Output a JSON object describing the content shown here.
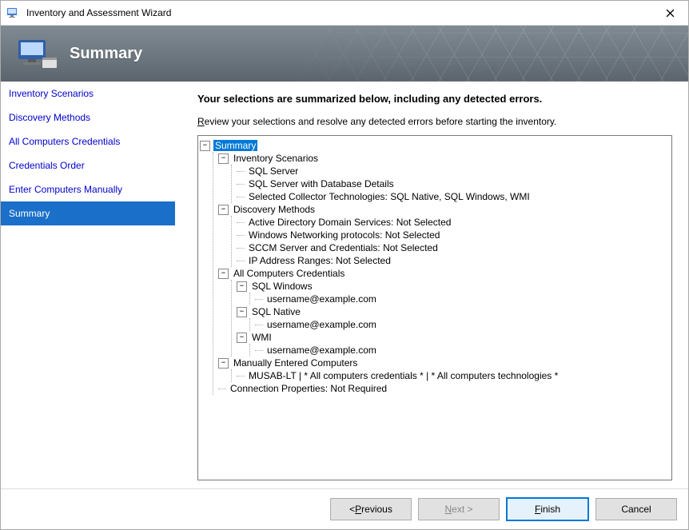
{
  "window": {
    "title": "Inventory and Assessment Wizard"
  },
  "banner": {
    "title": "Summary"
  },
  "sidebar": {
    "items": [
      {
        "label": "Inventory Scenarios",
        "active": false
      },
      {
        "label": "Discovery Methods",
        "active": false
      },
      {
        "label": "All Computers Credentials",
        "active": false
      },
      {
        "label": "Credentials Order",
        "active": false
      },
      {
        "label": "Enter Computers Manually",
        "active": false
      },
      {
        "label": "Summary",
        "active": true
      }
    ]
  },
  "content": {
    "heading": "Your selections are summarized below, including any detected errors.",
    "instruction_prefix": "R",
    "instruction_rest": "eview your selections and resolve any detected errors before starting the inventory."
  },
  "tree": {
    "root": "Summary",
    "nodes": {
      "inv_scenarios": {
        "label": "Inventory Scenarios",
        "items": [
          "SQL Server",
          "SQL Server with Database Details",
          "Selected Collector Technologies: SQL Native, SQL Windows, WMI"
        ]
      },
      "discovery": {
        "label": "Discovery Methods",
        "items": [
          "Active Directory Domain Services: Not Selected",
          "Windows Networking protocols: Not Selected",
          "SCCM Server and Credentials: Not Selected",
          "IP Address Ranges: Not Selected"
        ]
      },
      "creds": {
        "label": "All Computers Credentials",
        "groups": [
          {
            "label": "SQL Windows",
            "items": [
              "username@example.com"
            ]
          },
          {
            "label": "SQL Native",
            "items": [
              "username@example.com"
            ]
          },
          {
            "label": "WMI",
            "items": [
              "username@example.com"
            ]
          }
        ]
      },
      "manual": {
        "label": "Manually Entered Computers",
        "items": [
          "MUSAB-LT | * All computers credentials * | * All computers technologies *"
        ]
      },
      "conn": {
        "label": "Connection Properties: Not Required"
      }
    }
  },
  "buttons": {
    "previous_prefix": "< ",
    "previous_u": "P",
    "previous_rest": "revious",
    "next_u": "N",
    "next_rest": "ext >",
    "finish_u": "F",
    "finish_rest": "inish",
    "cancel": "Cancel"
  }
}
